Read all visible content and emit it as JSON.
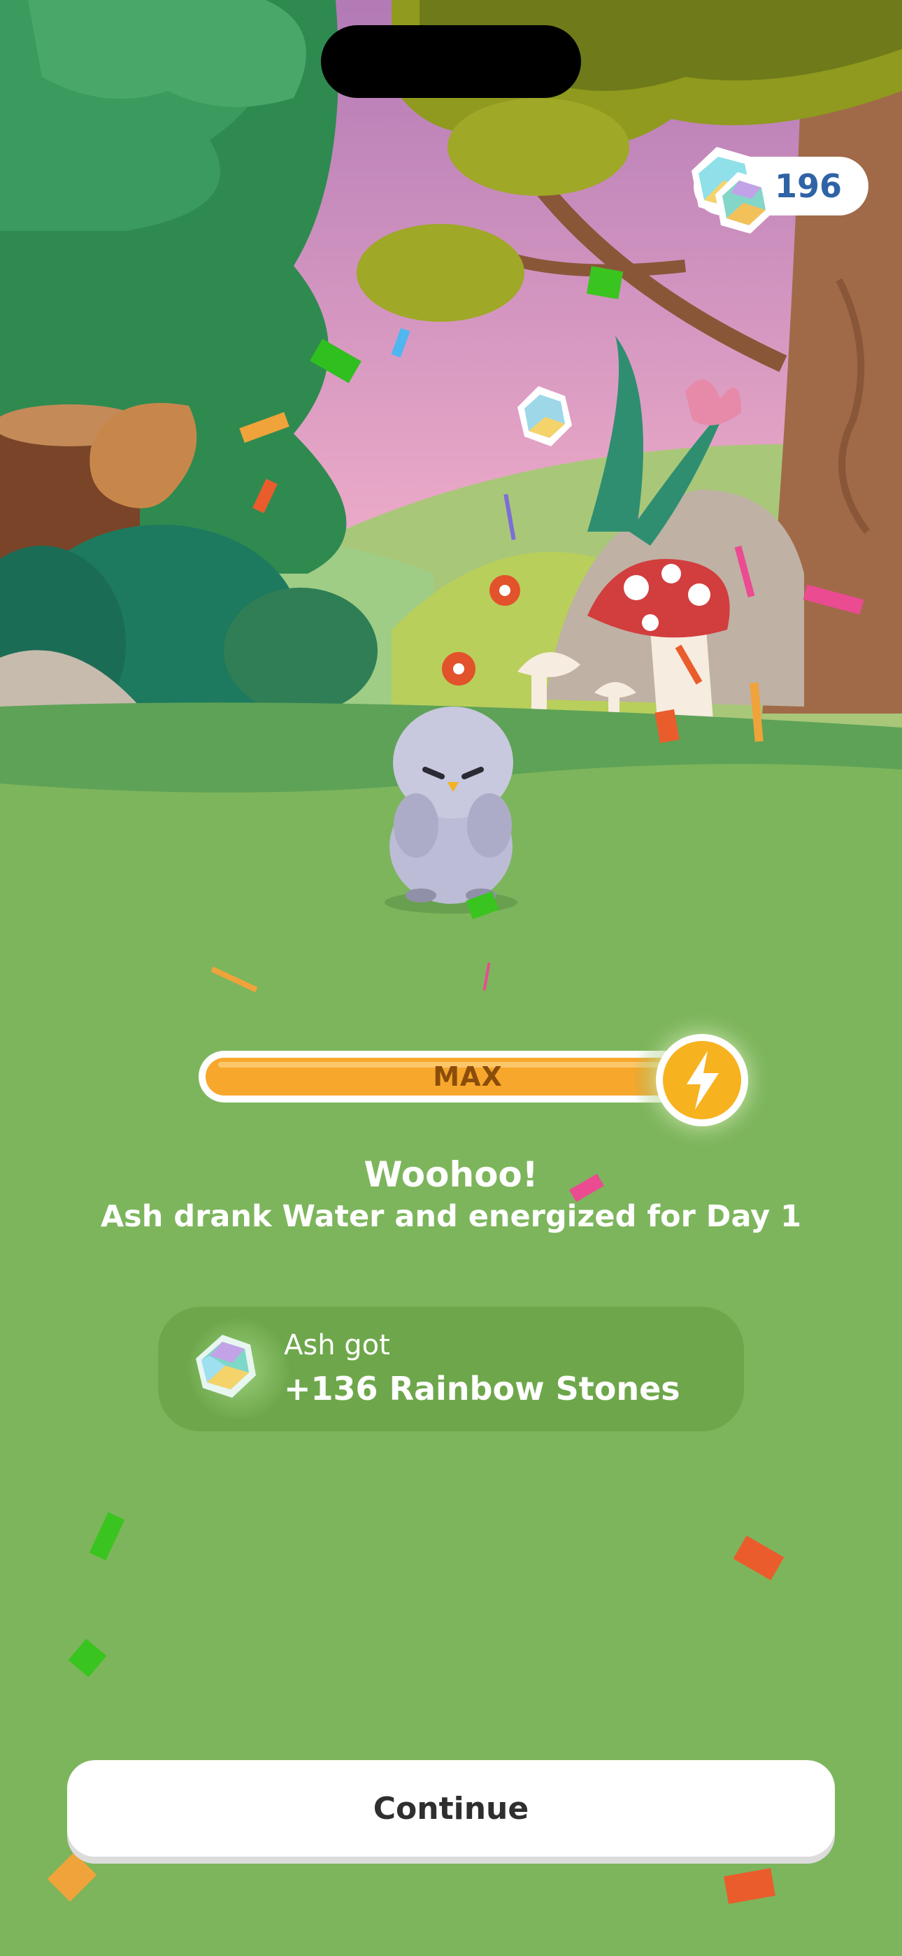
{
  "currency": {
    "count": "196",
    "icon": "rainbow-stone-icon"
  },
  "energy_bar": {
    "label": "MAX",
    "level_percent": 100,
    "fill_color": "#f7a72c",
    "icon": "lightning-bolt-icon"
  },
  "message": {
    "title": "Woohoo!",
    "subtitle": "Ash drank Water and energized for Day 1"
  },
  "reward": {
    "line1": "Ash got",
    "line2": "+136 Rainbow Stones",
    "icon": "rainbow-stone-icon"
  },
  "continue_button": {
    "label": "Continue"
  },
  "colors": {
    "grass": "#7db55c",
    "accent_orange": "#f7a72c",
    "counter_text": "#2f63a6"
  }
}
